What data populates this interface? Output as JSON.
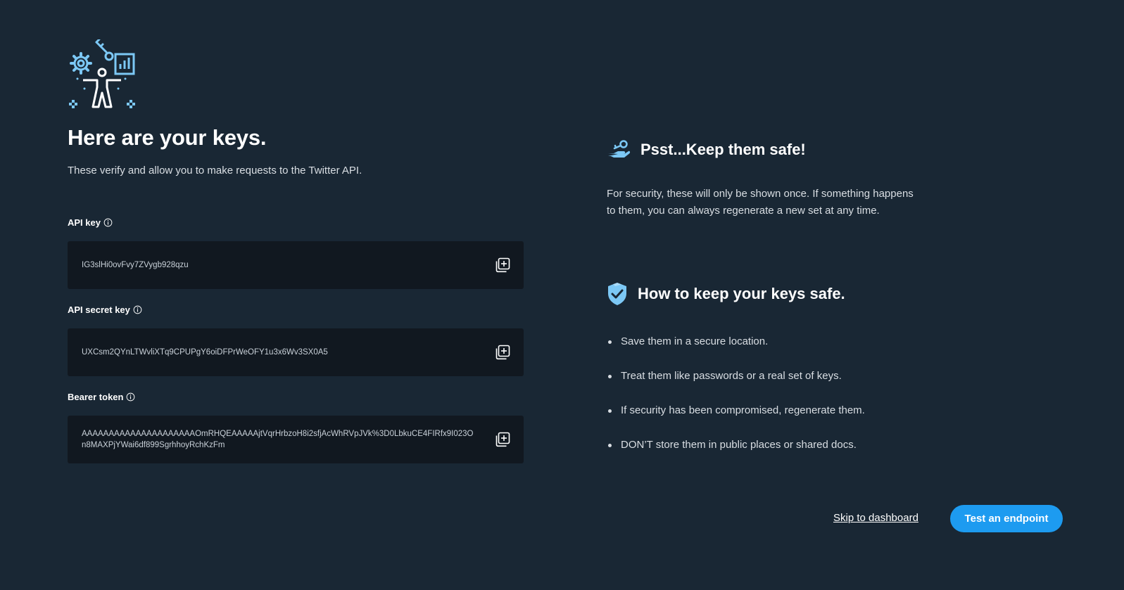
{
  "header": {
    "title": "Here are your keys.",
    "subtitle": "These verify and allow you to make requests to the Twitter API."
  },
  "keys": [
    {
      "label": "API key",
      "value": "IG3slHi0ovFvy7ZVygb928qzu"
    },
    {
      "label": "API secret key",
      "value": "UXCsm2QYnLTWvliXTq9CPUPgY6oiDFPrWeOFY1u3x6Wv3SX0A5"
    },
    {
      "label": "Bearer token",
      "value": "AAAAAAAAAAAAAAAAAAAAAOmRHQEAAAAAjtVqrHrbzoH8i2sfjAcWhRVpJVk%3D0LbkuCE4FIRfx9I023On8MAXPjYWai6df899SgrhhoyRchKzFm"
    }
  ],
  "safety": {
    "heading": "Psst...Keep them safe!",
    "text": "For security, these will only be shown once. If something happens to them, you can always regenerate a new set at any time."
  },
  "tips": {
    "heading": "How to keep your keys safe.",
    "items": [
      "Save them in a secure location.",
      "Treat them like passwords or a real set of keys.",
      "If security has been compromised, regenerate them.",
      "DON’T store them in public places or shared docs."
    ]
  },
  "actions": {
    "skip_label": "Skip to dashboard",
    "test_label": "Test an endpoint"
  },
  "colors": {
    "background": "#192734",
    "field_background": "#111820",
    "accent": "#1d9bf0",
    "icon_accent": "#7cc8f5"
  },
  "icons": {
    "hero": "developer-with-gear-key-chart-illustration",
    "info": "info-icon",
    "copy": "copy-icon",
    "safe": "hand-with-key-icon",
    "shield": "shield-check-icon"
  }
}
